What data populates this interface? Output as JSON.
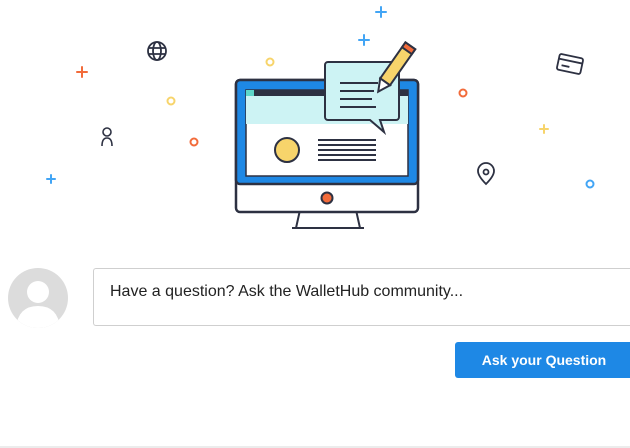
{
  "question": {
    "avatar_icon": "default-user-avatar",
    "prompt_text": "Have a question? Ask the WalletHub community...",
    "ask_button_label": "Ask your Question"
  },
  "illustration": {
    "description_icons": [
      "globe-icon",
      "user-icon",
      "credit-card-icon",
      "location-pin-icon",
      "computer-monitor-icon",
      "chat-bubble-icon",
      "pencil-icon"
    ]
  },
  "colors": {
    "accent_blue": "#1e88e5",
    "accent_orange": "#f26b3a",
    "accent_yellow": "#f7d46b",
    "outline_dark": "#2d3142",
    "screen_teal": "#cdf3f4"
  }
}
